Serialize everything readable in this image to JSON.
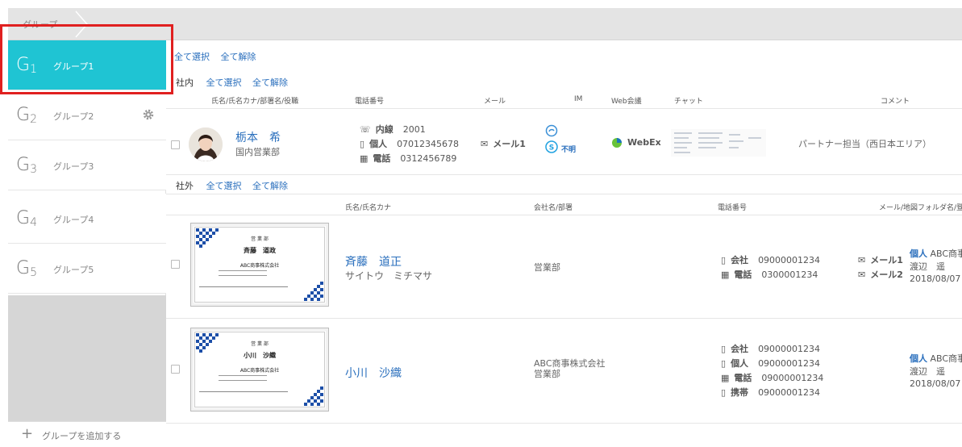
{
  "breadcrumb": {
    "root": "グループ"
  },
  "sidebar": {
    "groups": [
      {
        "letter": "G",
        "num": "1",
        "label": "グループ1",
        "active": true
      },
      {
        "letter": "G",
        "num": "2",
        "label": "グループ2",
        "active": false
      },
      {
        "letter": "G",
        "num": "3",
        "label": "グループ3",
        "active": false
      },
      {
        "letter": "G",
        "num": "4",
        "label": "グループ4",
        "active": false
      },
      {
        "letter": "G",
        "num": "5",
        "label": "グループ5",
        "active": false
      }
    ],
    "add_group": "グループを追加する"
  },
  "top_select": {
    "select_all": "全て選択",
    "deselect_all": "全て解除"
  },
  "internal": {
    "label": "社内",
    "select_all": "全て選択",
    "deselect_all": "全て解除",
    "headers": {
      "name": "氏名/氏名カナ/部署名/役職",
      "phone": "電話番号",
      "mail": "メール",
      "im": "IM",
      "web": "Web会議",
      "chat": "チャット",
      "comment": "コメント"
    },
    "row": {
      "name": "栃本　希",
      "dept": "国内営業部",
      "phones": [
        {
          "type": "内線",
          "number": "2001"
        },
        {
          "type": "個人",
          "number": "07012345678"
        },
        {
          "type": "電話",
          "number": "0312456789"
        }
      ],
      "mail": "メール1",
      "im_status": "不明",
      "web": "WebEx",
      "comment": "パートナー担当（西日本エリア）"
    }
  },
  "external": {
    "label": "社外",
    "select_all": "全て選択",
    "deselect_all": "全て解除",
    "headers": {
      "name": "氏名/氏名カナ",
      "company": "会社名/部署",
      "phone": "電話番号",
      "mail": "メール/地図",
      "folder": "フォルダ名/登録"
    },
    "rows": [
      {
        "card": {
          "dept": "営 業 部",
          "name": "斉藤　道政",
          "company": "ABC商事株式会社"
        },
        "name": "斉藤　道正",
        "kana": "サイトウ　ミチマサ",
        "company": "営業部",
        "company2": "",
        "phones": [
          {
            "type": "会社",
            "number": "09000001234"
          },
          {
            "type": "電話",
            "number": "0300001234"
          }
        ],
        "mails": [
          "メール1",
          "メール2"
        ],
        "folder_tag": "個人",
        "folder_name": "ABC商事株",
        "registrant": "渡辺　遥",
        "date": "2018/08/07"
      },
      {
        "card": {
          "dept": "営 業 部",
          "name": "小川　沙織",
          "company": "ABC商事株式会社"
        },
        "name": "小川　沙織",
        "kana": "",
        "company": "ABC商事株式会社",
        "company2": "営業部",
        "phones": [
          {
            "type": "会社",
            "number": "09000001234"
          },
          {
            "type": "個人",
            "number": "09000001234"
          },
          {
            "type": "電話",
            "number": "09000001234"
          },
          {
            "type": "携帯",
            "number": "09000001234"
          }
        ],
        "mails": [],
        "folder_tag": "個人",
        "folder_name": "ABC商事",
        "registrant": "渡辺　遥",
        "date": "2018/08/07"
      }
    ]
  },
  "colors": {
    "accent": "#1fc4d3",
    "link": "#2a6fbd",
    "highlight": "#e02020"
  }
}
